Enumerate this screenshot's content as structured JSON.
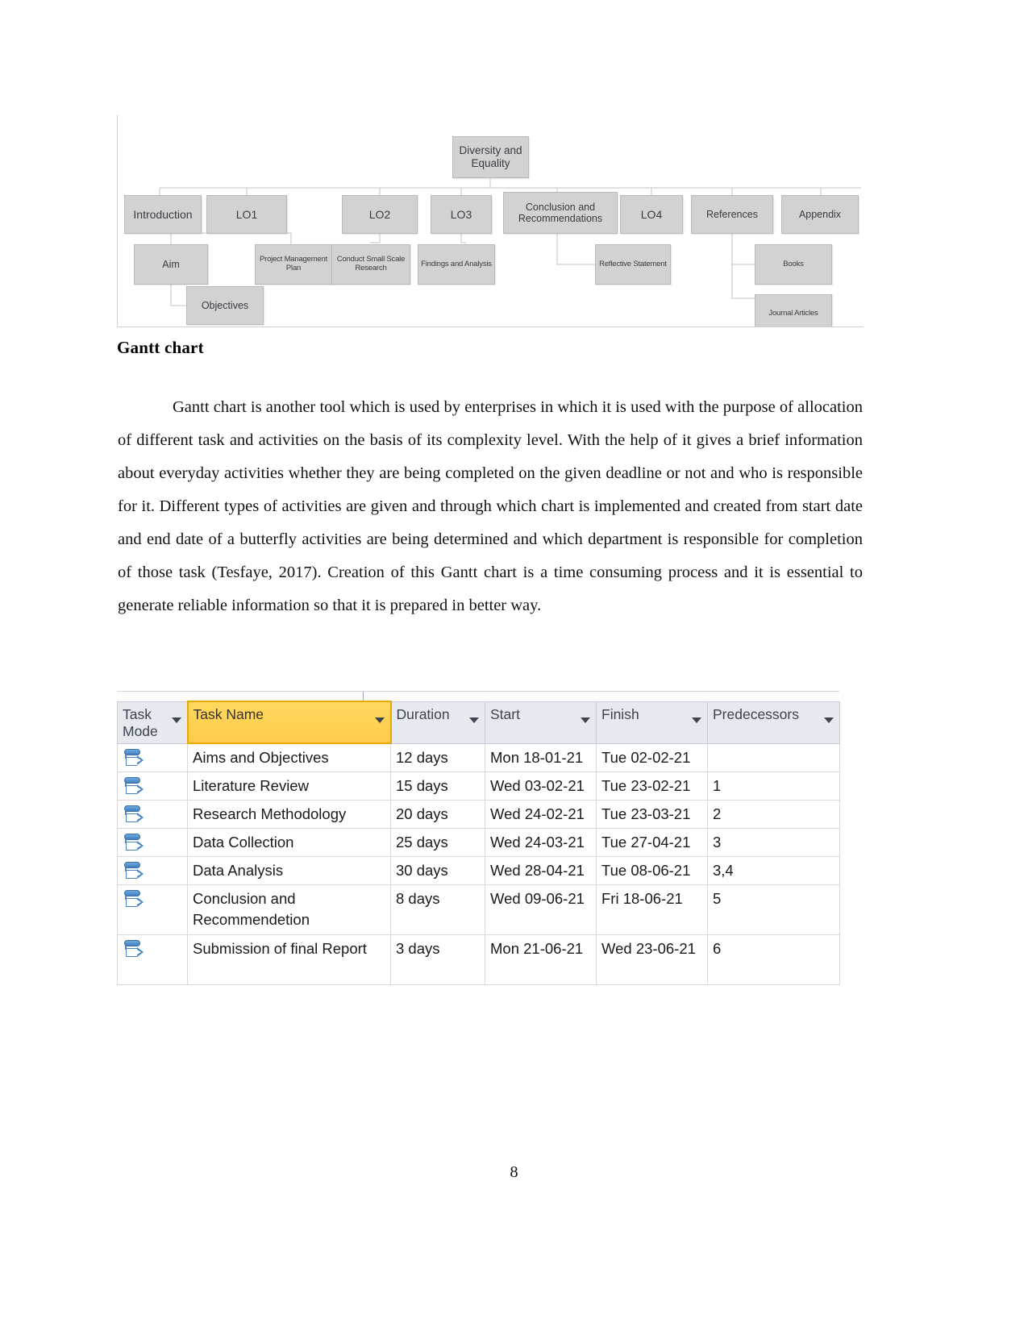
{
  "document": {
    "page_number": "8"
  },
  "figure": {
    "name": "work-breakdown-structure-diagram",
    "root": {
      "label": "Diversity and Equality"
    },
    "level1": [
      {
        "label": "Introduction"
      },
      {
        "label": "LO1"
      },
      {
        "label": "LO2"
      },
      {
        "label": "LO3"
      },
      {
        "label": "Conclusion and Recommendations"
      },
      {
        "label": "LO4"
      },
      {
        "label": "References"
      },
      {
        "label": "Appendix"
      }
    ],
    "level2": [
      {
        "label": "Aim"
      },
      {
        "label": "Project Management Plan"
      },
      {
        "label": "Conduct Small Scale Research"
      },
      {
        "label": "Findings and Analysis"
      },
      {
        "label": "Reflective Statement"
      },
      {
        "label": "Books"
      },
      {
        "label": "Journal Articles"
      }
    ],
    "level3": [
      {
        "label": "Objectives"
      }
    ]
  },
  "heading": {
    "gantt_chart": "Gantt chart"
  },
  "paragraph": {
    "gantt_body": "Gantt chart is another tool which is used by enterprises in which it is used with the purpose of allocation of different task and activities on the basis of its complexity level. With the help of it gives a brief information about everyday activities whether they are being completed on the given deadline or not and who is responsible for it. Different types of activities are given and through which chart is implemented and created from start date and end date of a butterfly activities are being determined and which department is responsible for completion of those task (Tesfaye, 2017). Creation of this Gantt chart is a time consuming process and it is essential to generate reliable information so that it is prepared in better way."
  },
  "gantt_table": {
    "columns": [
      {
        "key": "task_mode",
        "label": "Task Mode",
        "has_filter_arrow": true,
        "highlighted": false
      },
      {
        "key": "task_name",
        "label": "Task Name",
        "has_filter_arrow": true,
        "highlighted": true
      },
      {
        "key": "duration",
        "label": "Duration",
        "has_filter_arrow": true,
        "highlighted": false
      },
      {
        "key": "start",
        "label": "Start",
        "has_filter_arrow": true,
        "highlighted": false
      },
      {
        "key": "finish",
        "label": "Finish",
        "has_filter_arrow": true,
        "highlighted": false
      },
      {
        "key": "predecessors",
        "label": "Predecessors",
        "has_filter_arrow": true,
        "highlighted": false
      }
    ],
    "highlight_color": "#ffd35c",
    "header_background": "#e6eaee",
    "rows": [
      {
        "task_mode_icon": "manually-scheduled-icon",
        "task_name": "Aims and Objectives",
        "duration": "12 days",
        "start": "Mon 18-01-21",
        "finish": "Tue 02-02-21",
        "predecessors": ""
      },
      {
        "task_mode_icon": "manually-scheduled-icon",
        "task_name": "Literature Review",
        "duration": "15 days",
        "start": "Wed 03-02-21",
        "finish": "Tue 23-02-21",
        "predecessors": "1"
      },
      {
        "task_mode_icon": "manually-scheduled-icon",
        "task_name": "Research Methodology",
        "duration": "20 days",
        "start": "Wed 24-02-21",
        "finish": "Tue 23-03-21",
        "predecessors": "2"
      },
      {
        "task_mode_icon": "manually-scheduled-icon",
        "task_name": "Data Collection",
        "duration": "25 days",
        "start": "Wed 24-03-21",
        "finish": "Tue 27-04-21",
        "predecessors": "3"
      },
      {
        "task_mode_icon": "manually-scheduled-icon",
        "task_name": "Data Analysis",
        "duration": "30 days",
        "start": "Wed 28-04-21",
        "finish": "Tue 08-06-21",
        "predecessors": "3,4"
      },
      {
        "task_mode_icon": "manually-scheduled-icon",
        "task_name": "Conclusion and Recommendetion",
        "duration": "8 days",
        "start": "Wed 09-06-21",
        "finish": "Fri 18-06-21",
        "predecessors": "5"
      },
      {
        "task_mode_icon": "manually-scheduled-icon",
        "task_name": "Submission of final Report",
        "duration": "3 days",
        "start": "Mon 21-06-21",
        "finish": "Wed 23-06-21",
        "predecessors": "6"
      }
    ]
  }
}
